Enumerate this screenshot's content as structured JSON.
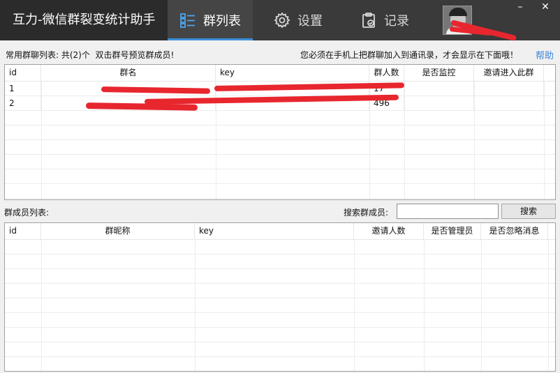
{
  "app": {
    "title": "互力-微信群裂变统计助手"
  },
  "nav": {
    "tabs": [
      {
        "label": "群列表",
        "icon": "list-icon",
        "active": true
      },
      {
        "label": "设置",
        "icon": "gear-icon",
        "active": false
      },
      {
        "label": "记录",
        "icon": "clipboard-check-icon",
        "active": false
      }
    ],
    "accent_color": "#3b8fd9"
  },
  "window": {
    "minimize": "–",
    "close": "✕"
  },
  "info": {
    "group_count_text": "常用群聊列表: 共(2)个",
    "hint_text": "双击群号预览群成员!",
    "notice_text": "您必须在手机上把群聊加入到通讯录，才会显示在下面哦！",
    "help_label": "帮助"
  },
  "groups_table": {
    "columns": [
      "id",
      "群名",
      "key",
      "群人数",
      "是否监控",
      "邀请进入此群"
    ],
    "rows": [
      {
        "id": "1",
        "name": "",
        "key": "",
        "count": "17",
        "monitor": "",
        "invite": ""
      },
      {
        "id": "2",
        "name": "",
        "key": "",
        "count": "496",
        "monitor": "",
        "invite": ""
      }
    ]
  },
  "members": {
    "label": "群成员列表:",
    "search_label": "搜索群成员:",
    "search_value": "",
    "search_button": "搜索",
    "columns": [
      "id",
      "群昵称",
      "key",
      "邀请人数",
      "是否管理员",
      "是否忽略消息"
    ],
    "rows": []
  }
}
